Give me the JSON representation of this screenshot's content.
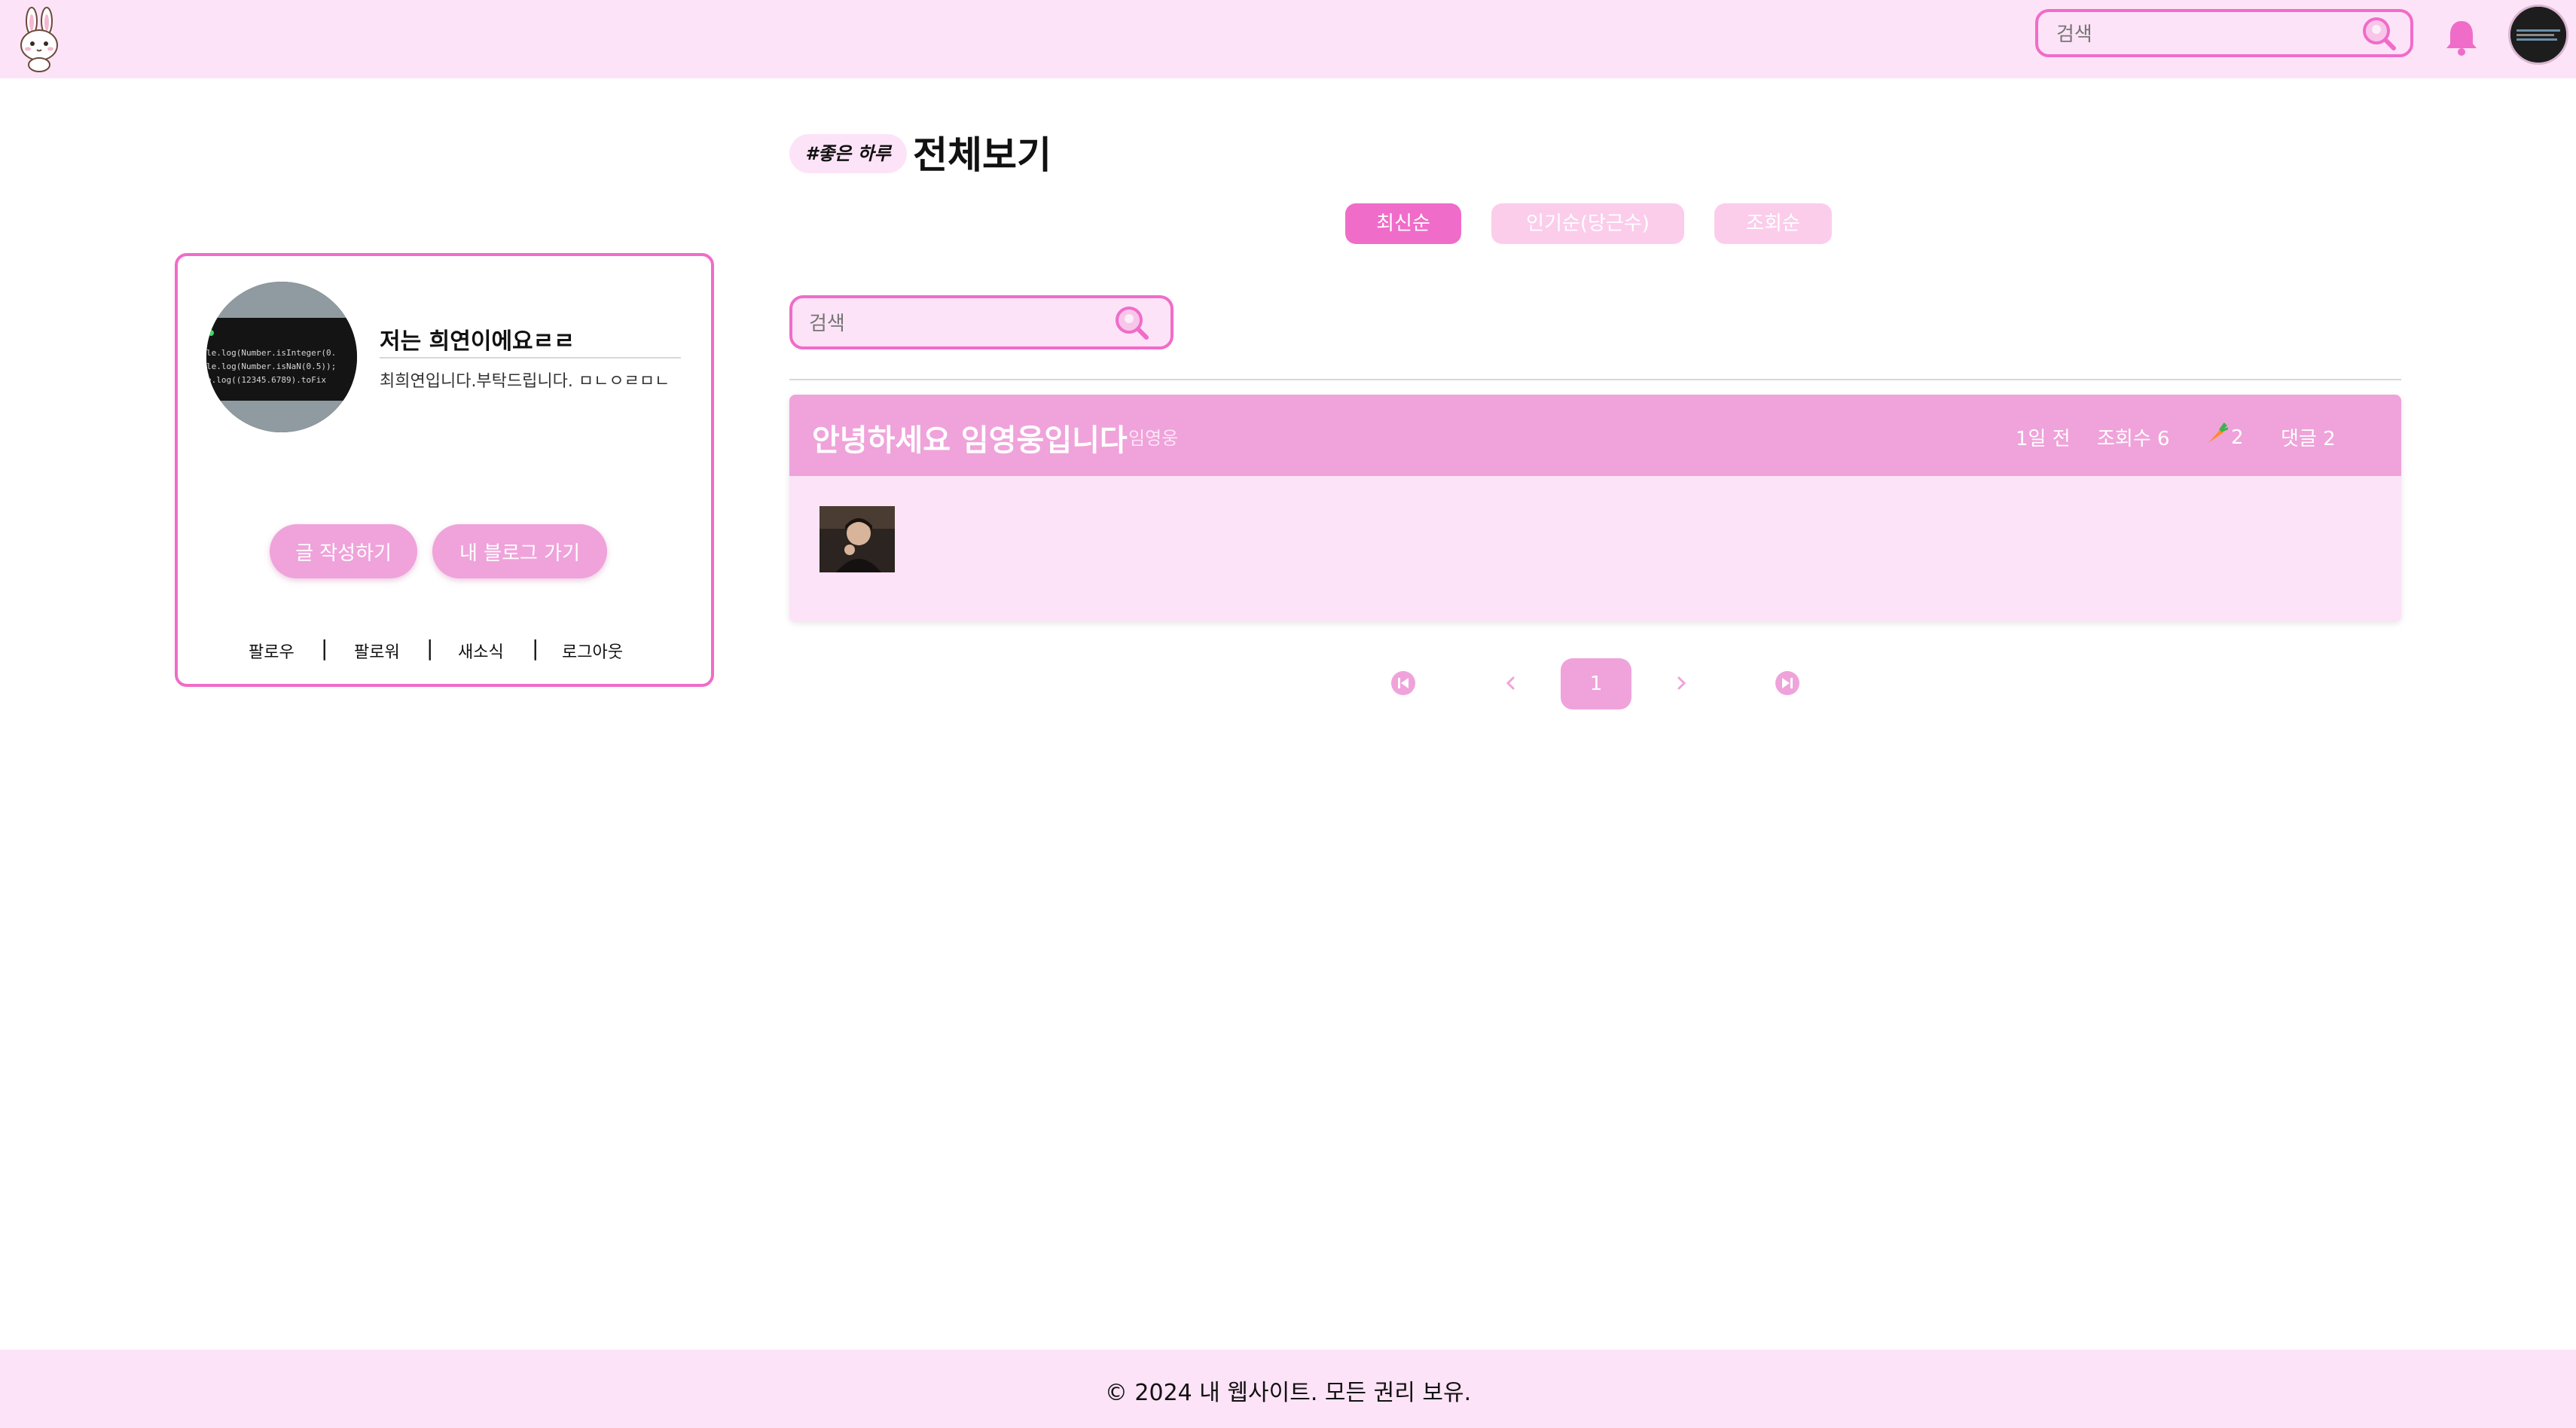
{
  "header": {
    "search_placeholder": "검색"
  },
  "profile": {
    "name": "저는 희연이에요ㄹㄹ",
    "intro": "최희연입니다.부탁드립니다. ㅁㄴㅇㄹㅁㄴ",
    "write_label": "글 작성하기",
    "myblog_label": "내 블로그 가기",
    "links": {
      "follow": "팔로우",
      "follower": "팔로워",
      "news": "새소식",
      "logout": "로그아웃"
    },
    "separator": "|"
  },
  "main": {
    "tag": "#좋은 하루",
    "title": "전체보기",
    "sort_tabs": [
      "최신순",
      "인기순(당근수)",
      "조회순"
    ],
    "search_placeholder": "검색"
  },
  "post": {
    "title": "안녕하세요 임영웅입니다",
    "author": "임영웅",
    "time": "1일 전",
    "views": "조회수 6",
    "likes": "2",
    "comments": "댓글 2"
  },
  "pagination": {
    "current_page": "1"
  },
  "footer": {
    "text": "© 2024 내 웹사이트. 모든 권리 보유."
  },
  "colors": {
    "accent": "#f06cc9",
    "accent_soft": "#efa3da",
    "background_pink": "#fde3f7",
    "tab_inactive": "#fbcdeb"
  }
}
